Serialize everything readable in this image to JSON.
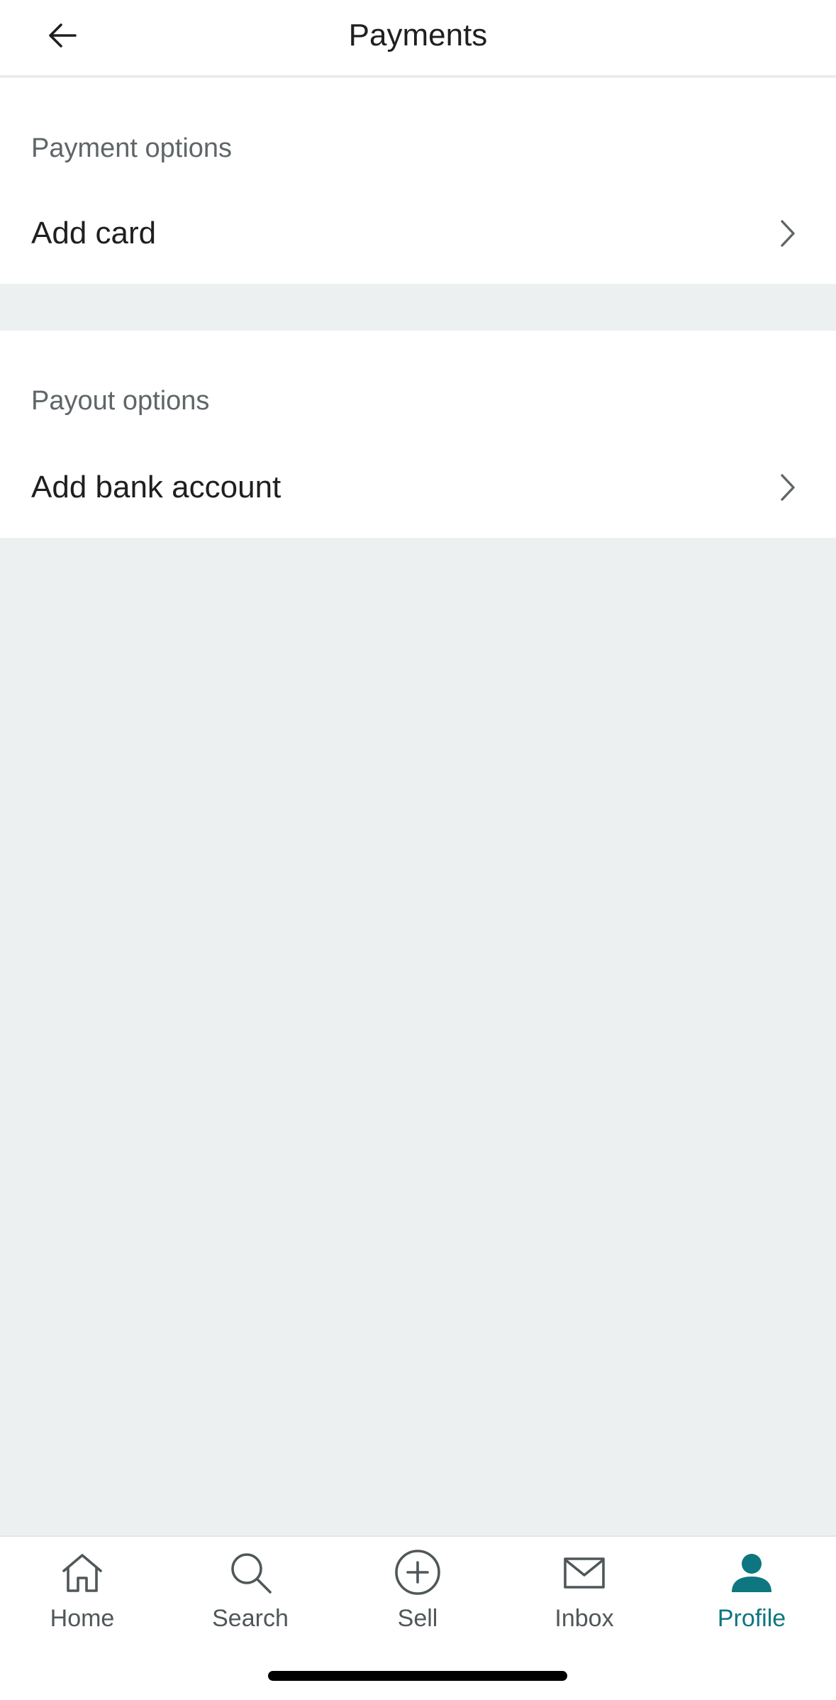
{
  "header": {
    "title": "Payments",
    "back_icon": "arrow-left-icon"
  },
  "payment_options": {
    "label": "Payment options",
    "row": {
      "label": "Add card",
      "icon": "chevron-right-icon"
    }
  },
  "payout_options": {
    "label": "Payout options",
    "row": {
      "label": "Add bank account",
      "icon": "chevron-right-icon"
    }
  },
  "bottom_nav": {
    "items": [
      {
        "label": "Home",
        "icon": "home-icon",
        "active": false
      },
      {
        "label": "Search",
        "icon": "search-icon",
        "active": false
      },
      {
        "label": "Sell",
        "icon": "plus-circle-icon",
        "active": false
      },
      {
        "label": "Inbox",
        "icon": "mail-icon",
        "active": false
      },
      {
        "label": "Profile",
        "icon": "person-icon",
        "active": true
      }
    ]
  },
  "colors": {
    "accent": "#0e7680",
    "background": "#edf0f1",
    "surface": "#ffffff",
    "text_primary": "#1f1f1f",
    "text_secondary": "#5f6668"
  }
}
